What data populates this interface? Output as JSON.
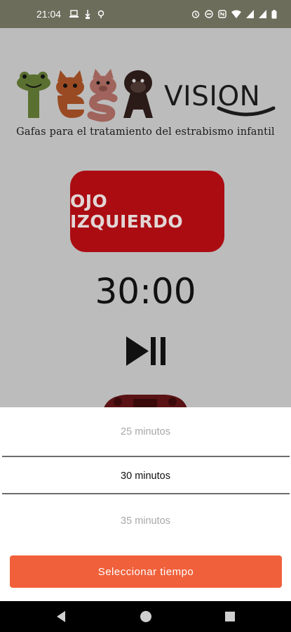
{
  "status_bar": {
    "time": "21:04",
    "left_icons": [
      "laptop-icon",
      "usb-icon",
      "location-icon"
    ],
    "right_icons": [
      "alarm-icon",
      "do-not-disturb-icon",
      "nfc-icon",
      "wifi-icon",
      "signal-icon",
      "signal-icon",
      "battery-icon"
    ]
  },
  "logo": {
    "brand": "TESA",
    "vision": "VISION",
    "tagline": "Gafas para el tratamiento del estrabismo infantil"
  },
  "eye_button": {
    "label": "OJO IZQUIERDO",
    "color": "#ab0c12"
  },
  "timer": {
    "display": "30:00"
  },
  "controls": {
    "play_pause_icon": "play-pause-icon"
  },
  "time_picker": {
    "options": [
      "25 minutos",
      "30 minutos",
      "35 minutos"
    ],
    "selected": "30 minutos"
  },
  "select_button": {
    "label": "Seleccionar tiempo",
    "color": "#f0603a"
  },
  "nav_bar": {
    "buttons": [
      "back-icon",
      "home-icon",
      "recents-icon"
    ]
  }
}
